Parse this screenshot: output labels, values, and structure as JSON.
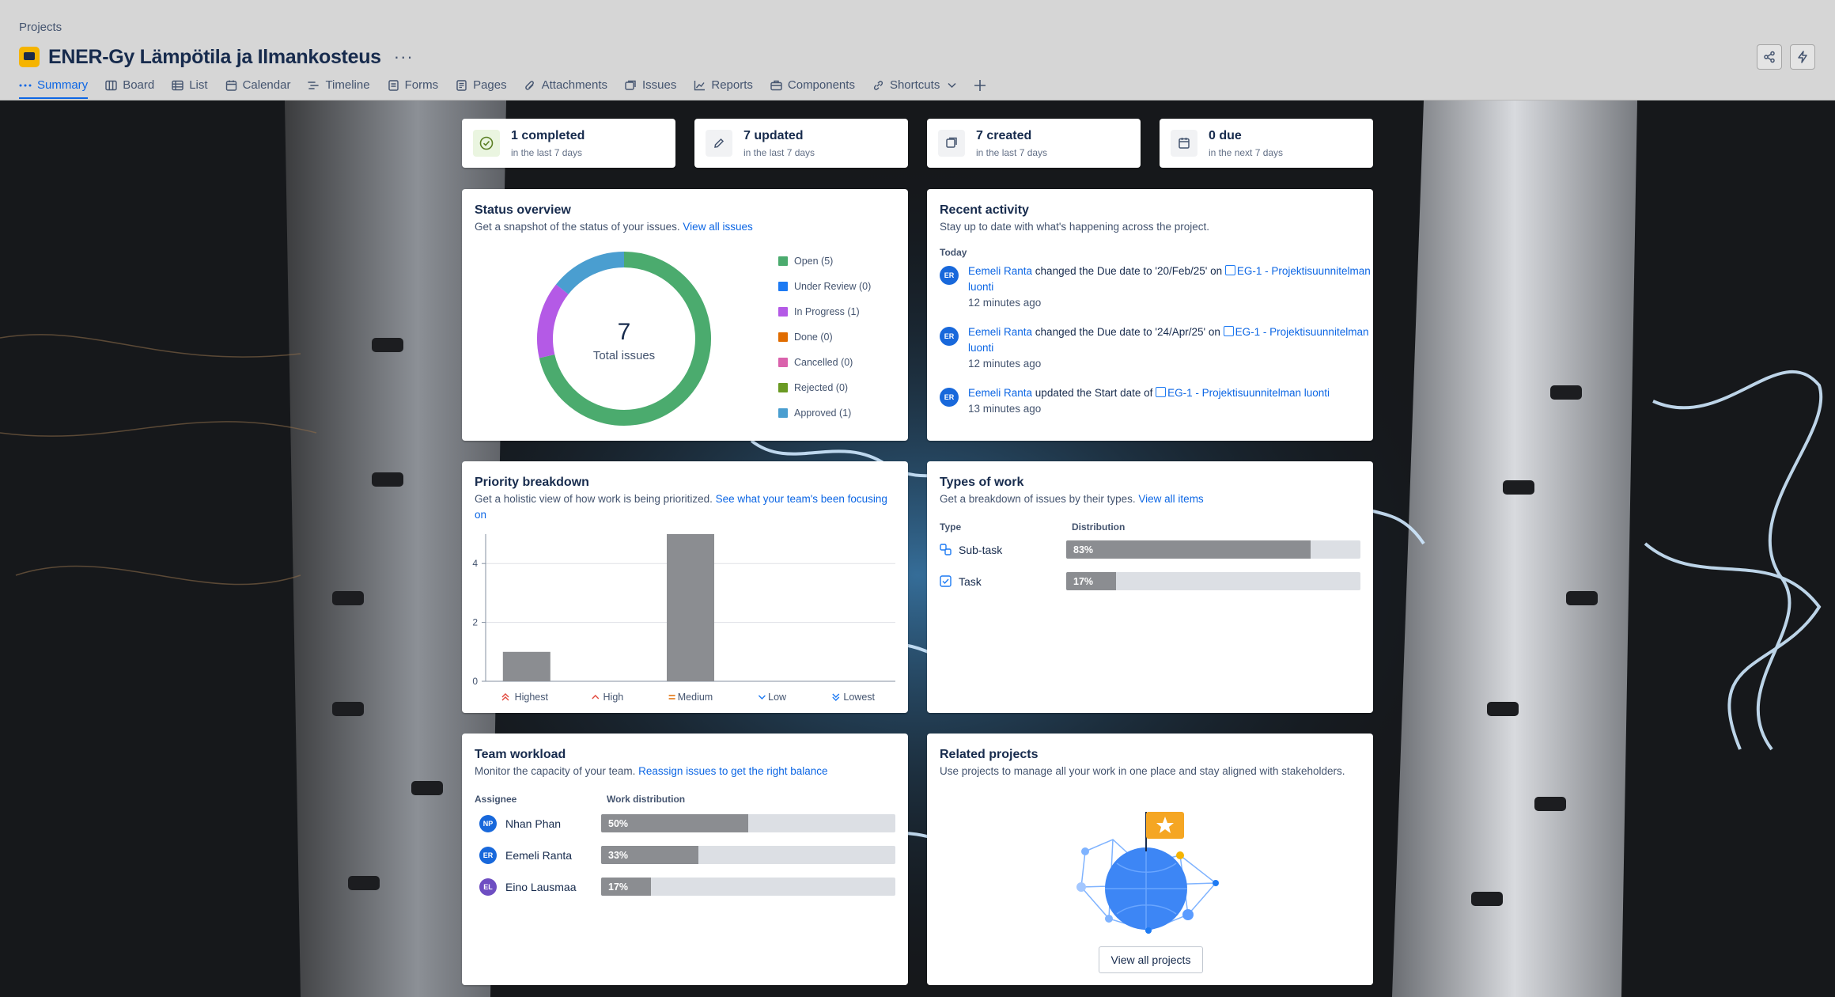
{
  "header": {
    "breadcrumb": "Projects",
    "title": "ENER-Gy Lämpötila ja Ilmankosteus",
    "more": "···"
  },
  "tabs": [
    {
      "label": "Summary",
      "icon": "dots-icon"
    },
    {
      "label": "Board",
      "icon": "board-icon"
    },
    {
      "label": "List",
      "icon": "list-icon"
    },
    {
      "label": "Calendar",
      "icon": "calendar-icon"
    },
    {
      "label": "Timeline",
      "icon": "timeline-icon"
    },
    {
      "label": "Forms",
      "icon": "forms-icon"
    },
    {
      "label": "Pages",
      "icon": "pages-icon"
    },
    {
      "label": "Attachments",
      "icon": "paperclip-icon"
    },
    {
      "label": "Issues",
      "icon": "issues-icon"
    },
    {
      "label": "Reports",
      "icon": "reports-icon"
    },
    {
      "label": "Components",
      "icon": "components-icon"
    },
    {
      "label": "Shortcuts",
      "icon": "link-icon"
    }
  ],
  "stats": [
    {
      "main": "1 completed",
      "sub": "in the last 7 days"
    },
    {
      "main": "7 updated",
      "sub": "in the last 7 days"
    },
    {
      "main": "7 created",
      "sub": "in the last 7 days"
    },
    {
      "main": "0 due",
      "sub": "in the next 7 days"
    }
  ],
  "status_overview": {
    "title": "Status overview",
    "desc": "Get a snapshot of the status of your issues.",
    "link": "View all issues",
    "total": "7",
    "total_label": "Total issues",
    "legend": [
      {
        "label": "Open (5)",
        "color": "#4bab6e"
      },
      {
        "label": "Under Review (0)",
        "color": "#1d7af3"
      },
      {
        "label": "In Progress (1)",
        "color": "#b45ae6"
      },
      {
        "label": "Done (0)",
        "color": "#e06c00"
      },
      {
        "label": "Cancelled (0)",
        "color": "#da62ac"
      },
      {
        "label": "Rejected (0)",
        "color": "#6a9a23"
      },
      {
        "label": "Approved (1)",
        "color": "#4a9ed0"
      }
    ]
  },
  "recent_activity": {
    "title": "Recent activity",
    "desc": "Stay up to date with what's happening across the project.",
    "day": "Today",
    "items": [
      {
        "initials": "ER",
        "user": "Eemeli Ranta",
        "action": " changed the Due date to '20/Feb/25' on ",
        "issue": "EG-1 - Projektisuunnitelman luonti",
        "time": "12 minutes ago"
      },
      {
        "initials": "ER",
        "user": "Eemeli Ranta",
        "action": " changed the Due date to '24/Apr/25' on ",
        "issue": "EG-1 - Projektisuunnitelman luonti",
        "time": "12 minutes ago"
      },
      {
        "initials": "ER",
        "user": "Eemeli Ranta",
        "action": " updated the Start date of ",
        "issue": "EG-1 - Projektisuunnitelman luonti",
        "time": "13 minutes ago"
      }
    ]
  },
  "priority": {
    "title": "Priority breakdown",
    "desc": "Get a holistic view of how work is being prioritized.",
    "link": "See what your team's been focusing on"
  },
  "chart_data": {
    "type": "bar",
    "categories": [
      "Highest",
      "High",
      "Medium",
      "Low",
      "Lowest"
    ],
    "values": [
      1,
      0,
      5,
      0,
      0
    ],
    "yticks": [
      "0",
      "2",
      "4"
    ],
    "ylim": [
      0,
      5
    ],
    "grid": true
  },
  "types": {
    "title": "Types of work",
    "desc": "Get a breakdown of issues by their types.",
    "link": "View all items",
    "col_type": "Type",
    "col_dist": "Distribution",
    "rows": [
      {
        "label": "Sub-task",
        "percent": 83,
        "text": "83%"
      },
      {
        "label": "Task",
        "percent": 17,
        "text": "17%"
      }
    ]
  },
  "workload": {
    "title": "Team workload",
    "desc": "Monitor the capacity of your team.",
    "link": "Reassign issues to get the right balance",
    "col_assignee": "Assignee",
    "col_dist": "Work distribution",
    "rows": [
      {
        "initials": "NP",
        "name": "Nhan Phan",
        "percent": 50,
        "text": "50%",
        "color": "#1868db"
      },
      {
        "initials": "ER",
        "name": "Eemeli Ranta",
        "percent": 33,
        "text": "33%",
        "color": "#1868db"
      },
      {
        "initials": "EL",
        "name": "Eino Lausmaa",
        "percent": 17,
        "text": "17%",
        "color": "#6e4ec2"
      }
    ]
  },
  "related": {
    "title": "Related projects",
    "desc": "Use projects to manage all your work in one place and stay aligned with stakeholders.",
    "button": "View all projects"
  }
}
